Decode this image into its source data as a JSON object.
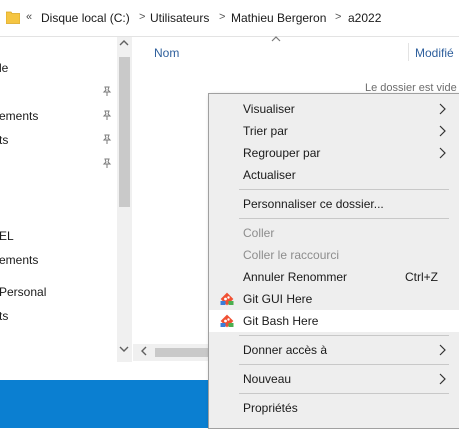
{
  "breadcrumb": {
    "more": "«",
    "items": [
      "Disque local (C:)",
      "Utilisateurs",
      "Mathieu Bergeron",
      "a2022"
    ]
  },
  "nav": {
    "items": [
      "le",
      "ements",
      "ts",
      "EL",
      "ements",
      "Personal",
      "ts"
    ]
  },
  "columns": {
    "name": "Nom",
    "modified": "Modifié"
  },
  "content": {
    "empty_message": "Le dossier est vide"
  },
  "menu": {
    "visualiser": "Visualiser",
    "trier": "Trier par",
    "regrouper": "Regrouper par",
    "actualiser": "Actualiser",
    "personnaliser": "Personnaliser ce dossier...",
    "coller": "Coller",
    "coller_raccourci": "Coller le raccourci",
    "annuler": "Annuler Renommer",
    "annuler_shortcut": "Ctrl+Z",
    "git_gui": "Git GUI Here",
    "git_bash": "Git Bash Here",
    "donner_acces": "Donner accès à",
    "nouveau": "Nouveau",
    "proprietes": "Propriétés"
  },
  "colors": {
    "taskbar": "#0b7fd1",
    "menu_bg": "#eeeeee",
    "column_header": "#2e5f9c",
    "folder": "#f5c542",
    "git": "#f05033"
  },
  "icons": {
    "folder": "folder-icon",
    "pin": "pin-icon",
    "submenu": "chevron-right-icon",
    "git": "git-icon"
  }
}
